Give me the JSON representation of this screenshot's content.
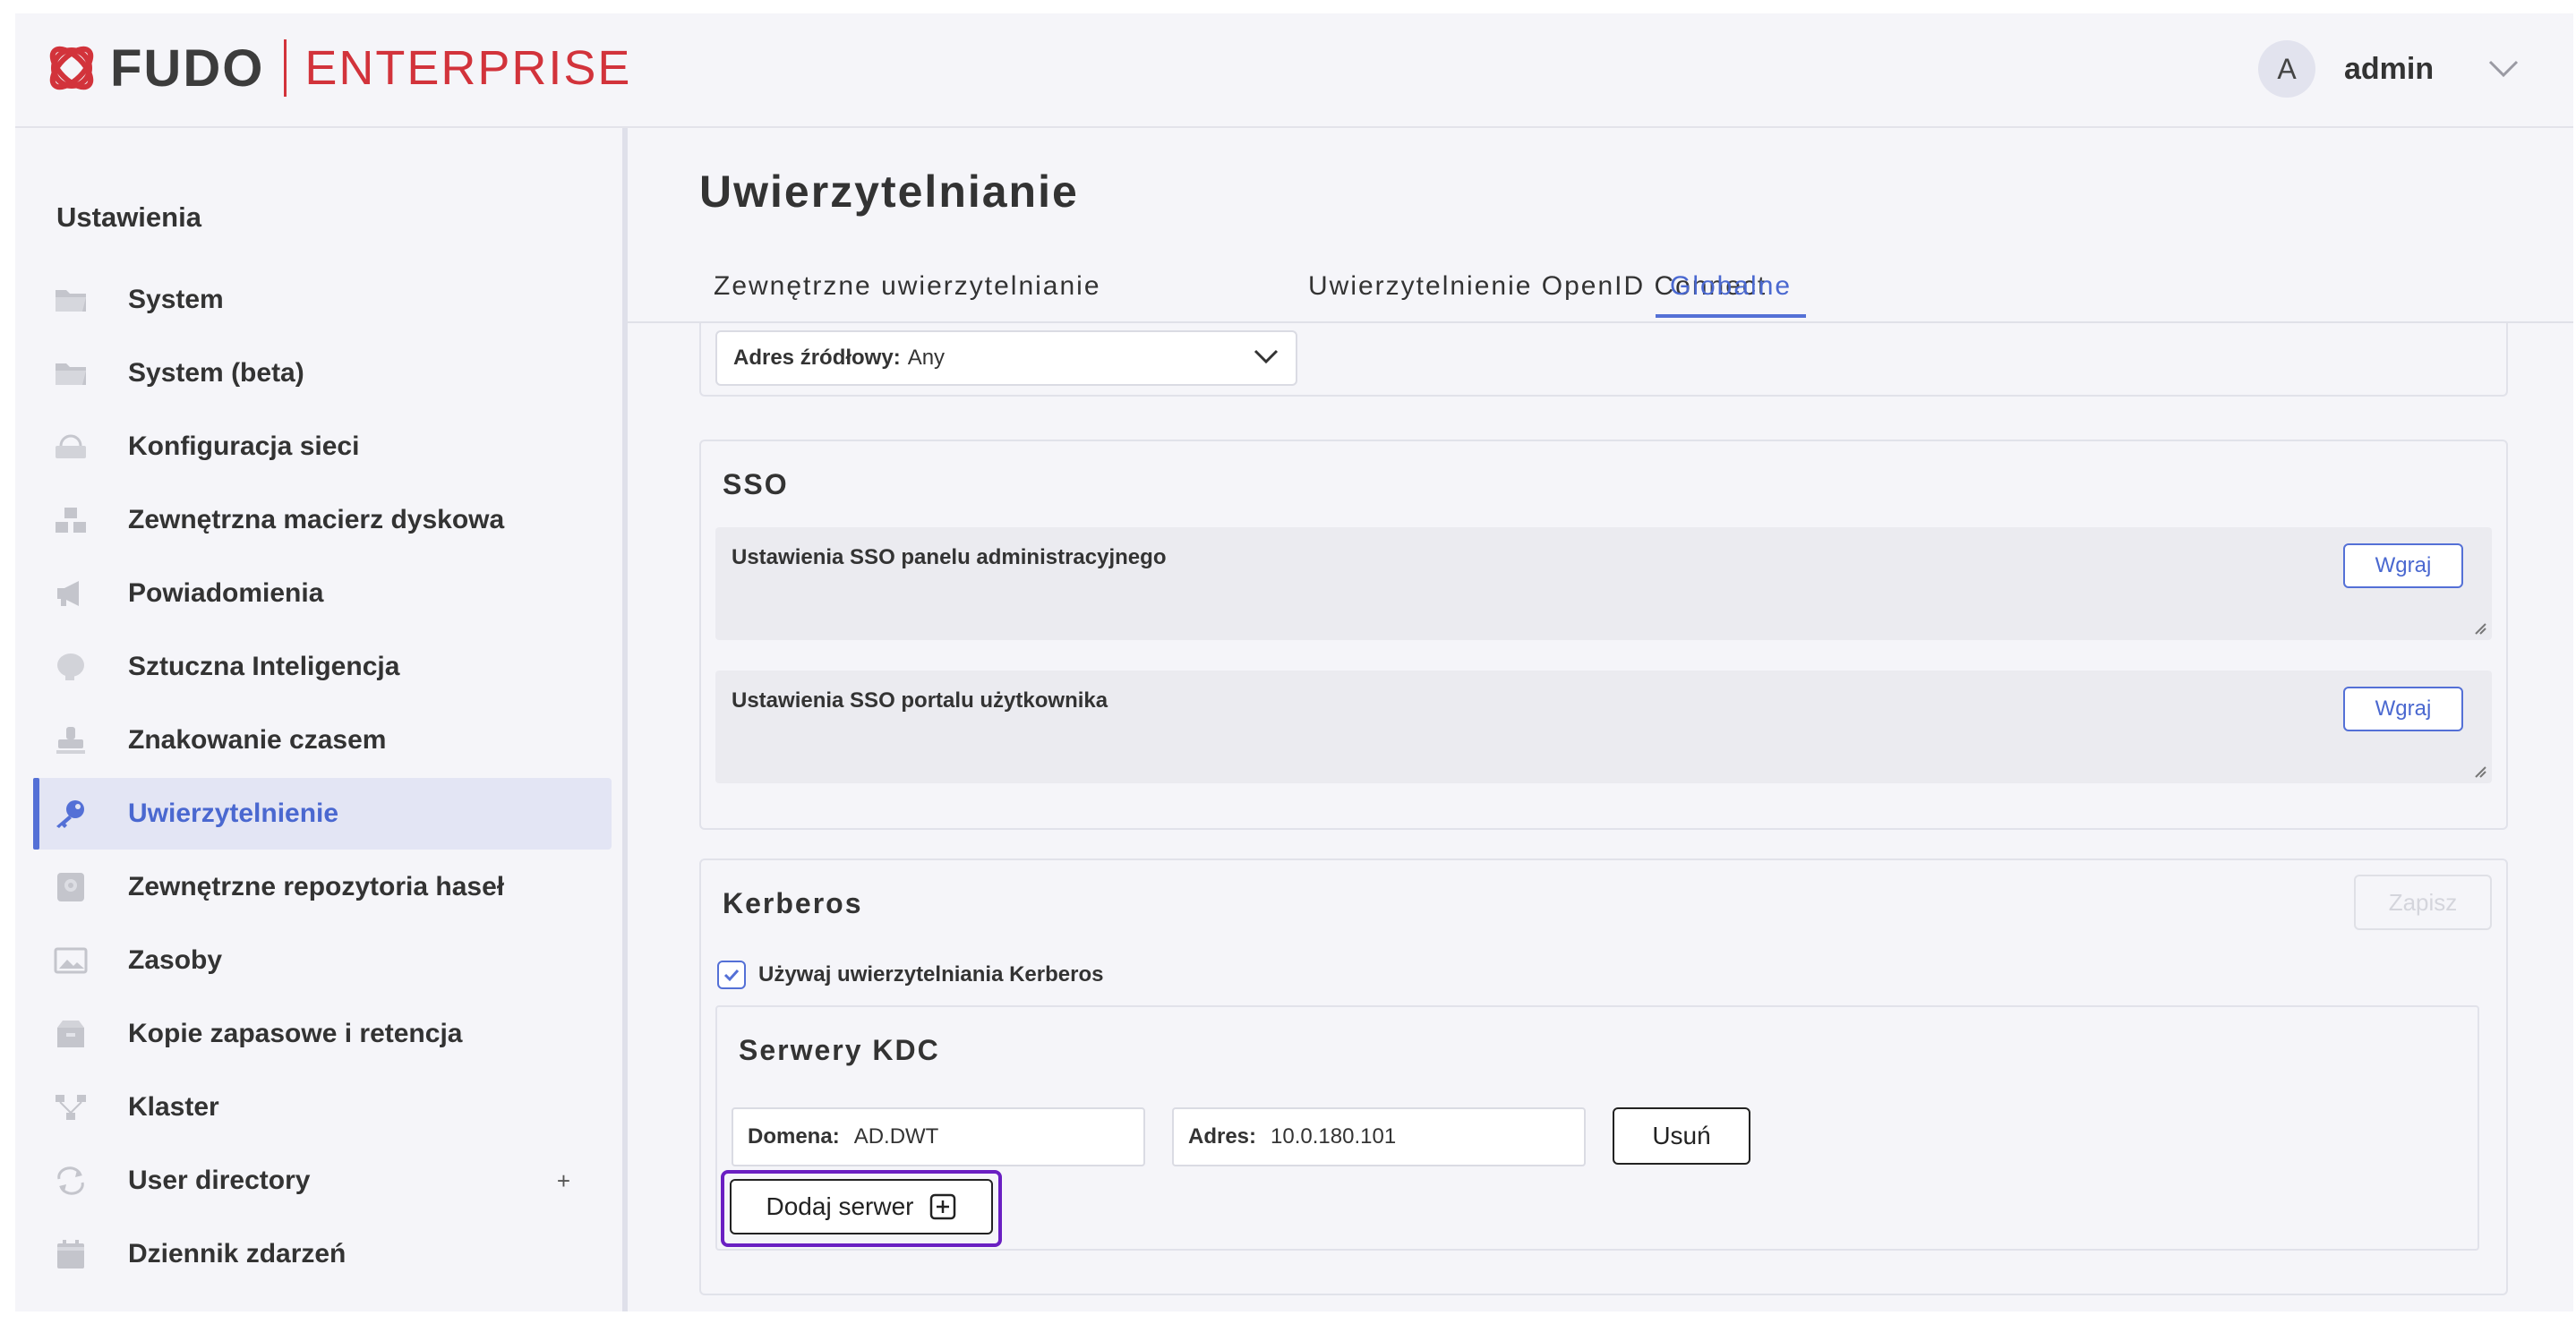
{
  "header": {
    "logo_main": "FUDO",
    "logo_sub": "ENTERPRISE",
    "avatar_letter": "A",
    "user_name": "admin"
  },
  "sidebar": {
    "title": "Ustawienia",
    "items": [
      {
        "label": "System",
        "icon": "folder-icon"
      },
      {
        "label": "System (beta)",
        "icon": "folder-icon"
      },
      {
        "label": "Konfiguracja sieci",
        "icon": "network-icon"
      },
      {
        "label": "Zewnętrzna macierz dyskowa",
        "icon": "storage-icon"
      },
      {
        "label": "Powiadomienia",
        "icon": "megaphone-icon"
      },
      {
        "label": "Sztuczna Inteligencja",
        "icon": "brain-icon"
      },
      {
        "label": "Znakowanie czasem",
        "icon": "stamp-icon"
      },
      {
        "label": "Uwierzytelnienie",
        "icon": "key-icon",
        "active": true
      },
      {
        "label": "Zewnętrzne repozytoria haseł",
        "icon": "vault-icon"
      },
      {
        "label": "Zasoby",
        "icon": "image-icon"
      },
      {
        "label": "Kopie zapasowe i retencja",
        "icon": "backup-icon"
      },
      {
        "label": "Klaster",
        "icon": "cluster-icon"
      },
      {
        "label": "User directory",
        "icon": "sync-icon",
        "expand": "+"
      },
      {
        "label": "Dziennik zdarzeń",
        "icon": "calendar-icon"
      }
    ]
  },
  "main": {
    "title": "Uwierzytelnianie",
    "tabs": [
      {
        "label": "Zewnętrzne uwierzytelnianie"
      },
      {
        "label": "Uwierzytelnienie OpenID Connect"
      },
      {
        "label": "Globalne",
        "active": true
      }
    ],
    "source_address": {
      "label": "Adres źródłowy:",
      "value": "Any"
    },
    "sso": {
      "title": "SSO",
      "admin_panel": {
        "label": "Ustawienia SSO panelu administracyjnego",
        "button": "Wgraj"
      },
      "user_portal": {
        "label": "Ustawienia SSO portalu użytkownika",
        "button": "Wgraj"
      }
    },
    "kerberos": {
      "title": "Kerberos",
      "save_button": "Zapisz",
      "use_checkbox": {
        "label": "Używaj uwierzytelniania Kerberos",
        "checked": true
      },
      "kdc": {
        "title": "Serwery KDC",
        "domain_label": "Domena:",
        "domain_value": "AD.DWT",
        "address_label": "Adres:",
        "address_value": "10.0.180.101",
        "remove_button": "Usuń",
        "add_button": "Dodaj serwer"
      }
    }
  },
  "colors": {
    "accent": "#5470d6",
    "brand": "#d2333b",
    "highlight": "#6a1fc2"
  }
}
